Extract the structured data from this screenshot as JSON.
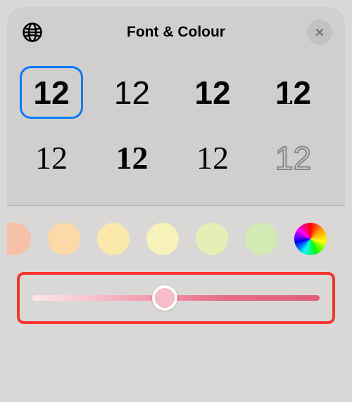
{
  "header": {
    "title": "Font & Colour",
    "globe_icon": "globe-icon",
    "close_icon": "close-icon"
  },
  "fonts": {
    "sample_text": "12",
    "items": [
      {
        "id": 1,
        "selected": true,
        "style": "rounded-semibold"
      },
      {
        "id": 2,
        "selected": false,
        "style": "light"
      },
      {
        "id": 3,
        "selected": false,
        "style": "bold"
      },
      {
        "id": 4,
        "selected": false,
        "style": "stencil"
      },
      {
        "id": 5,
        "selected": false,
        "style": "serif"
      },
      {
        "id": 6,
        "selected": false,
        "style": "serif-black"
      },
      {
        "id": 7,
        "selected": false,
        "style": "didot"
      },
      {
        "id": 8,
        "selected": false,
        "style": "outline"
      }
    ]
  },
  "colors": {
    "swatches": [
      "#f7c1a9",
      "#fcd9a6",
      "#fbe8ab",
      "#f6f2b9",
      "#e5efb5",
      "#d2eab4"
    ],
    "picker": "conic-rainbow"
  },
  "slider": {
    "value": 0.47,
    "thumb_color": "#f6bcc8",
    "gradient_start": "#fce8ec",
    "gradient_end": "#df5f7c",
    "highlight_color": "#fc322f"
  }
}
